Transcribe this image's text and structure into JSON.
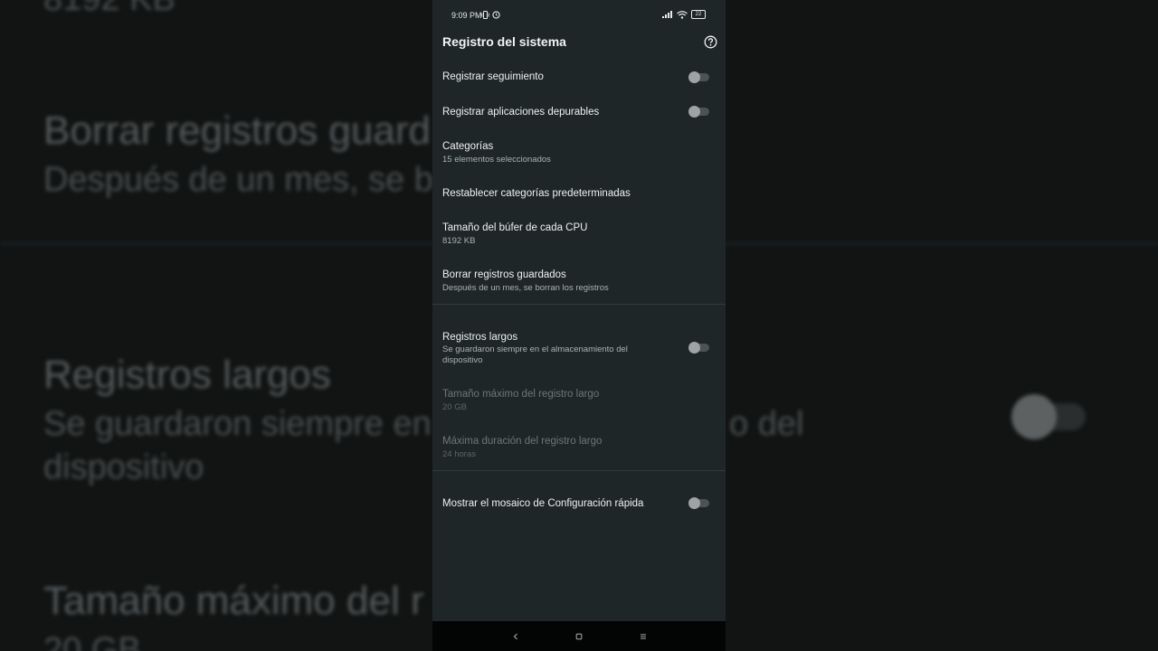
{
  "background": {
    "fragments": [
      {
        "text": "8192 KB",
        "kind": "sub"
      },
      {
        "text": "Borrar registros guard",
        "kind": "title"
      },
      {
        "text": "Después de un mes, se b",
        "kind": "sub"
      },
      {
        "text": "Registros largos",
        "kind": "title"
      },
      {
        "text": "Se guardaron siempre en",
        "kind": "sub"
      },
      {
        "text": "o del",
        "kind": "sub"
      },
      {
        "text": "dispositivo",
        "kind": "sub"
      },
      {
        "text": "Tamaño máximo del r",
        "kind": "title"
      },
      {
        "text": "20 GB",
        "kind": "sub"
      }
    ]
  },
  "status_bar": {
    "time": "9:09 PM",
    "battery": "22"
  },
  "header": {
    "title": "Registro del sistema",
    "help_icon": "question-circle-icon"
  },
  "settings": [
    {
      "title": "Registrar seguimiento",
      "toggle": false
    },
    {
      "title": "Registrar aplicaciones depurables",
      "toggle": false
    },
    {
      "title": "Categorías",
      "subtitle": "15 elementos seleccionados"
    },
    {
      "title": "Restablecer categorías predeterminadas"
    },
    {
      "title": "Tamaño del búfer de cada CPU",
      "subtitle": "8192 KB"
    },
    {
      "title": "Borrar registros guardados",
      "subtitle": "Después de un mes, se borran los registros"
    },
    {
      "title": "Registros largos",
      "subtitle": "Se guardaron siempre en el almacenamiento del dispositivo",
      "toggle": false
    },
    {
      "title": "Tamaño máximo del registro largo",
      "subtitle": "20 GB",
      "disabled": true
    },
    {
      "title": "Máxima duración del registro largo",
      "subtitle": "24 horas",
      "disabled": true
    },
    {
      "title": "Mostrar el mosaico de Configuración rápida",
      "toggle": false
    }
  ],
  "nav_bar": {
    "back_icon": "chevron-left-icon",
    "home_icon": "square-home-icon",
    "recents_icon": "menu-lines-icon"
  },
  "colors": {
    "panel": "#1e2627",
    "text": "#eef1f1",
    "subtext": "#aab3b4",
    "disabled": "#6e7677"
  }
}
